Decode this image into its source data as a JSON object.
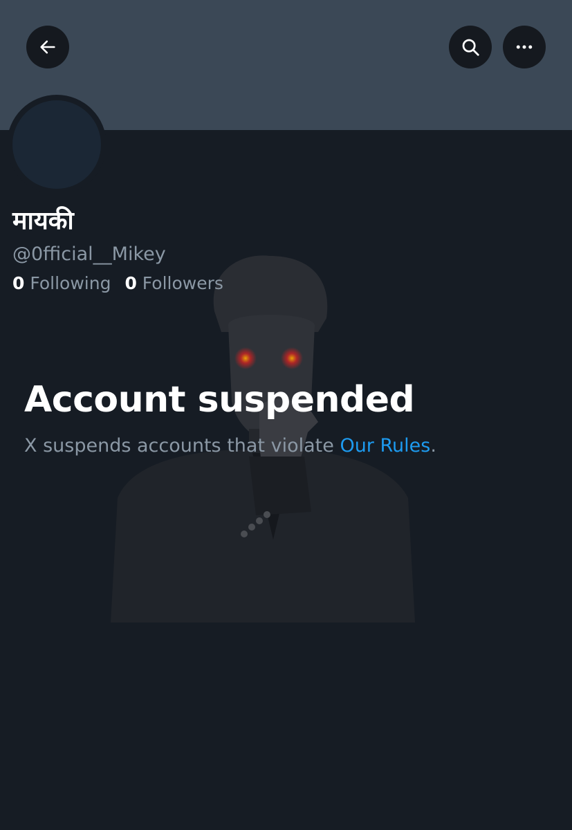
{
  "header": {
    "back_icon": "arrow-left-icon",
    "search_icon": "search-icon",
    "more_icon": "more-horizontal-icon"
  },
  "profile": {
    "display_name": "मायकी",
    "handle": "@0fficial__Mikey",
    "following_count": "0",
    "following_label": "Following",
    "followers_count": "0",
    "followers_label": "Followers"
  },
  "suspension": {
    "title": "Account suspended",
    "description_prefix": "X suspends accounts that violate ",
    "rules_link": "Our Rules",
    "description_suffix": "."
  },
  "colors": {
    "background": "#161c24",
    "banner": "#3b4856",
    "button_bg": "#15191f",
    "secondary_text": "#8b98a5",
    "link": "#1d9bf0"
  }
}
